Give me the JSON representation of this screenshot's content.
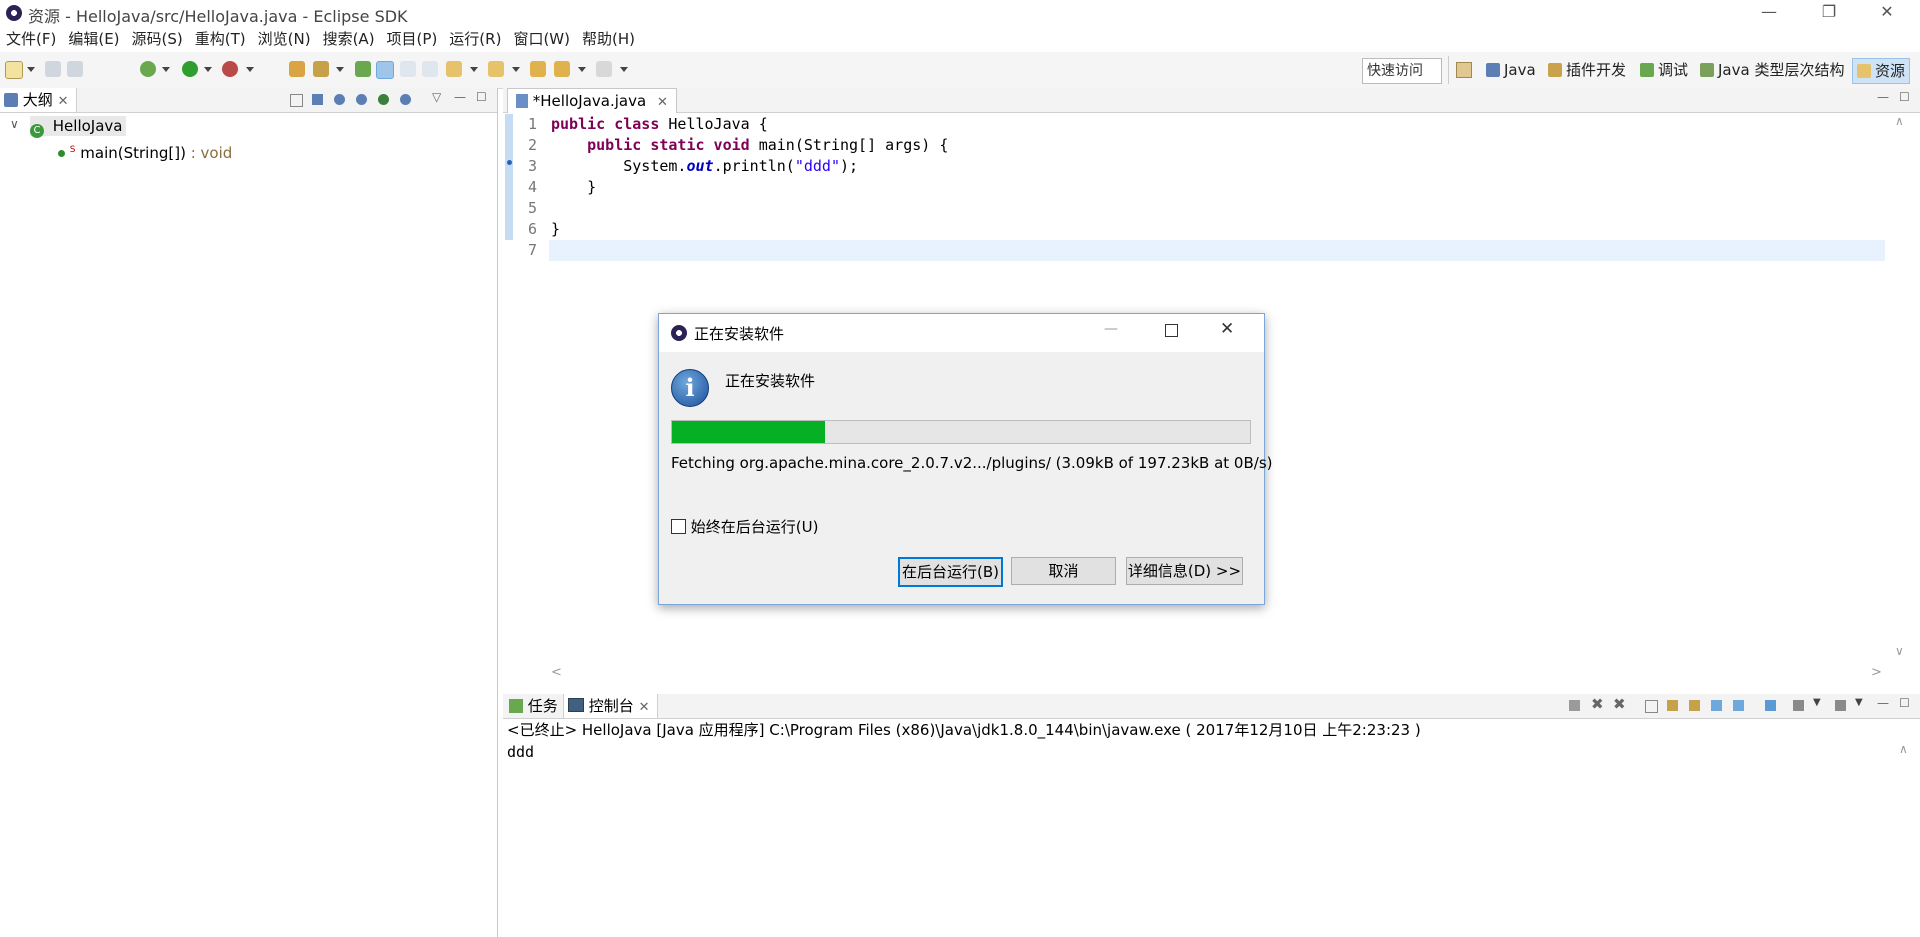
{
  "window": {
    "title": "资源 - HelloJava/src/HelloJava.java - Eclipse SDK",
    "minimize": "—",
    "restore": "❐",
    "close": "✕"
  },
  "menu": [
    "文件(F)",
    "编辑(E)",
    "源码(S)",
    "重构(T)",
    "浏览(N)",
    "搜索(A)",
    "项目(P)",
    "运行(R)",
    "窗口(W)",
    "帮助(H)"
  ],
  "toolbar": {
    "quick_access": "快速访问",
    "perspectives": [
      "Java",
      "插件开发",
      "调试",
      "Java 类型层次结构",
      "资源"
    ]
  },
  "outline": {
    "tab_label": "大纲",
    "class_name": "HelloJava",
    "method_name": "main(String[])",
    "method_return": " : void",
    "static_marker": "S"
  },
  "editor": {
    "tab_label": "*HelloJava.java",
    "lines": [
      {
        "n": "1",
        "parts": [
          {
            "t": "public class",
            "c": "kw"
          },
          {
            "t": " HelloJava {",
            "c": ""
          }
        ]
      },
      {
        "n": "2",
        "parts": [
          {
            "t": "    ",
            "c": ""
          },
          {
            "t": "public static void",
            "c": "kw"
          },
          {
            "t": " main(String[] args) {",
            "c": ""
          }
        ]
      },
      {
        "n": "3",
        "parts": [
          {
            "t": "        System.",
            "c": ""
          },
          {
            "t": "out",
            "c": "fld"
          },
          {
            "t": ".println(",
            "c": ""
          },
          {
            "t": "\"ddd\"",
            "c": "str"
          },
          {
            "t": ");",
            "c": ""
          }
        ]
      },
      {
        "n": "4",
        "parts": [
          {
            "t": "    }",
            "c": ""
          }
        ]
      },
      {
        "n": "5",
        "parts": [
          {
            "t": "",
            "c": ""
          }
        ]
      },
      {
        "n": "6",
        "parts": [
          {
            "t": "}",
            "c": ""
          }
        ]
      },
      {
        "n": "7",
        "parts": [
          {
            "t": "",
            "c": ""
          }
        ]
      }
    ]
  },
  "console": {
    "tab_tasks": "任务",
    "tab_console": "控制台",
    "status_line": "<已终止> HelloJava [Java 应用程序] C:\\Program Files (x86)\\Java\\jdk1.8.0_144\\bin\\javaw.exe ( 2017年12月10日 上午2:23:23 )",
    "output": "ddd"
  },
  "dialog": {
    "title": "正在安装软件",
    "heading": "正在安装软件",
    "progress_fraction": 0.265,
    "progress_color": "#06b025",
    "status": "Fetching org.apache.mina.core_2.0.7.v2.../plugins/ (3.09kB of 197.23kB at 0B/s)",
    "checkbox_label": "始终在后台运行(U)",
    "checkbox_checked": false,
    "btn_background": "在后台运行(B)",
    "btn_cancel": "取消",
    "btn_details": "详细信息(D) >>"
  }
}
